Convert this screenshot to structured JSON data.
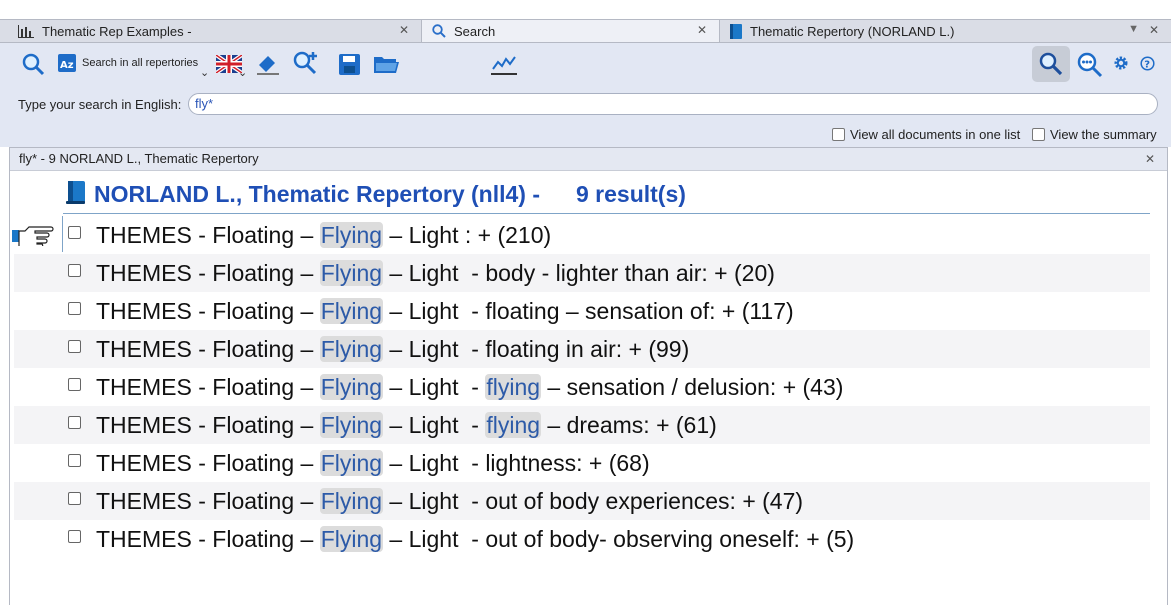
{
  "tabs": [
    {
      "label": "Thematic Rep Examples -",
      "icon": "bar-chart-icon",
      "active": false
    },
    {
      "label": "Search",
      "icon": "search-icon",
      "active": true
    },
    {
      "label": "Thematic Repertory (NORLAND L.)",
      "icon": "book-icon",
      "active": false
    }
  ],
  "toolbar": {
    "search_all_label": "Search in all repertories",
    "language": "English"
  },
  "search": {
    "label": "Type your search in English:",
    "value": "fly*"
  },
  "options": {
    "view_all": "View all documents in one list",
    "view_summary": "View the summary"
  },
  "result_bar": {
    "title": "fly* - 9 NORLAND L., Thematic Repertory"
  },
  "results": {
    "repertory_title": "NORLAND L., Thematic Repertory (nll4) -",
    "count_label": "9 result(s)",
    "rows": [
      {
        "pre": "THEMES - Floating – ",
        "hl1": "Flying",
        "mid": " – Light : + (210)",
        "hl2": "",
        "post": ""
      },
      {
        "pre": "THEMES - Floating – ",
        "hl1": "Flying",
        "mid": " – Light  - body - lighter than air: + (20)",
        "hl2": "",
        "post": ""
      },
      {
        "pre": "THEMES - Floating – ",
        "hl1": "Flying",
        "mid": " – Light  - floating – sensation of: + (117)",
        "hl2": "",
        "post": ""
      },
      {
        "pre": "THEMES - Floating – ",
        "hl1": "Flying",
        "mid": " – Light  - floating in air: + (99)",
        "hl2": "",
        "post": ""
      },
      {
        "pre": "THEMES - Floating – ",
        "hl1": "Flying",
        "mid": " – Light  - ",
        "hl2": "flying",
        "post": " – sensation / delusion: + (43)"
      },
      {
        "pre": "THEMES - Floating – ",
        "hl1": "Flying",
        "mid": " – Light  - ",
        "hl2": "flying",
        "post": " – dreams: + (61)"
      },
      {
        "pre": "THEMES - Floating – ",
        "hl1": "Flying",
        "mid": " – Light  - lightness: + (68)",
        "hl2": "",
        "post": ""
      },
      {
        "pre": "THEMES - Floating – ",
        "hl1": "Flying",
        "mid": " – Light  - out of body experiences: + (47)",
        "hl2": "",
        "post": ""
      },
      {
        "pre": "THEMES - Floating – ",
        "hl1": "Flying",
        "mid": " – Light  - out of body- observing oneself: + (5)",
        "hl2": "",
        "post": ""
      }
    ]
  },
  "colors": {
    "accent": "#1f4fb5",
    "highlight_text": "#2c5aa8",
    "highlight_bg": "#dcdcdc",
    "toolbar_bg": "#e2e7f3"
  }
}
